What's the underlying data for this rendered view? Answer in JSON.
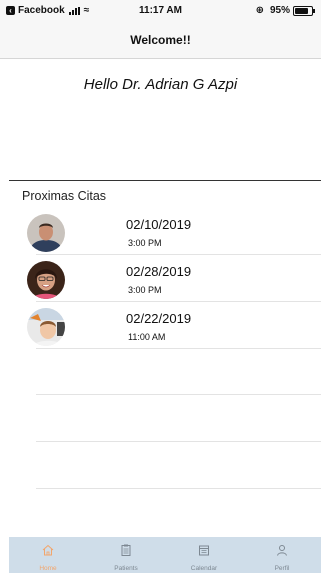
{
  "status_bar": {
    "back_app": "Facebook",
    "time": "11:17 AM",
    "battery": "95%",
    "battery_level": 0.95
  },
  "nav": {
    "title": "Welcome!!"
  },
  "greeting": "Hello Dr. Adrian G Azpi",
  "appointments_section": {
    "title": "Proximas Citas",
    "items": [
      {
        "date": "02/10/2019",
        "time": "3:00 PM"
      },
      {
        "date": "02/28/2019",
        "time": "3:00 PM"
      },
      {
        "date": "02/22/2019",
        "time": "11:00 AM"
      }
    ]
  },
  "tab_bar": {
    "active_tab": "Home",
    "tabs": [
      {
        "label": "Home",
        "icon": "home-icon"
      },
      {
        "label": "Patients",
        "icon": "clipboard-icon"
      },
      {
        "label": "Calendar",
        "icon": "calendar-icon"
      },
      {
        "label": "Perfil",
        "icon": "person-icon"
      }
    ]
  },
  "colors": {
    "tab_bar_bg": "#cfdde9",
    "tab_active": "#f3a56b",
    "tab_inactive": "#7d8892"
  }
}
